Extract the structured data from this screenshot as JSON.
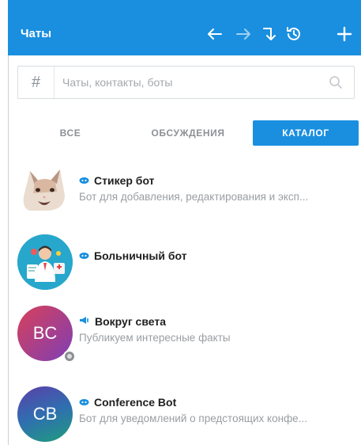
{
  "header": {
    "title": "Чаты",
    "icons": [
      "arrow-left-icon",
      "arrow-right-icon",
      "turn-down-arrow-icon",
      "history-icon",
      "plus-icon"
    ],
    "color": "#1a8fdf"
  },
  "search": {
    "hash_symbol": "#",
    "placeholder": "Чаты, контакты, боты"
  },
  "tabs": [
    {
      "label": "ВСЕ",
      "active": false
    },
    {
      "label": "ОБСУЖДЕНИЯ",
      "active": false
    },
    {
      "label": "КАТАЛОГ",
      "active": true
    }
  ],
  "chats": [
    {
      "type_icon": "bot-icon",
      "name": "Стикер бот",
      "subtitle": "Бот для добавления, редактирования и эксп...",
      "avatar": "cat-image"
    },
    {
      "type_icon": "bot-icon",
      "name": "Больничный бот",
      "subtitle": "",
      "avatar": "doctor-image"
    },
    {
      "type_icon": "channel-icon",
      "name": "Вокруг света",
      "subtitle": "Публикуем интересные факты",
      "avatar_initials": "BC",
      "avatar_colors": [
        "#d8405a",
        "#7e3fb5"
      ]
    },
    {
      "type_icon": "bot-icon",
      "name": "Conference Bot",
      "subtitle": "Бот для уведомлений о предстоящих конфе...",
      "avatar_initials": "CB",
      "avatar_colors": [
        "#5b3fa8",
        "#1f9d7c"
      ]
    }
  ]
}
